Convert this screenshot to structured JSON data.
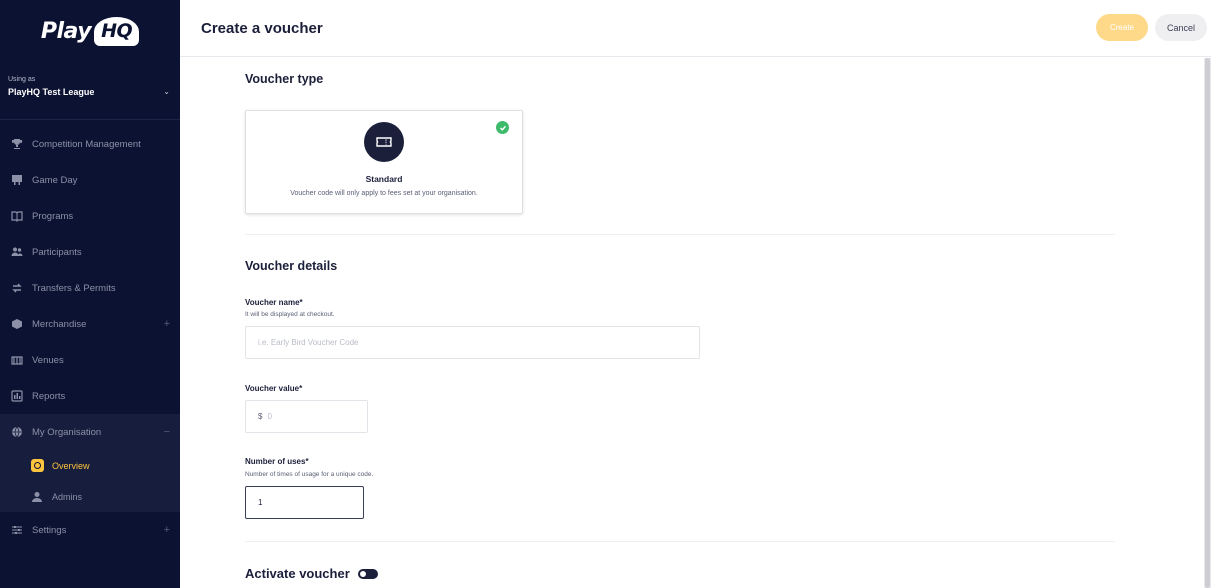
{
  "app": {
    "logo_text": "Play",
    "logo_hq": "HQ"
  },
  "sidebar": {
    "using_label": "Using as",
    "org_name": "PlayHQ Test League",
    "items": [
      {
        "label": "Competition Management",
        "icon": "trophy-icon"
      },
      {
        "label": "Game Day",
        "icon": "scoreboard-icon"
      },
      {
        "label": "Programs",
        "icon": "book-icon"
      },
      {
        "label": "Participants",
        "icon": "people-icon"
      },
      {
        "label": "Transfers & Permits",
        "icon": "transfer-icon"
      },
      {
        "label": "Merchandise",
        "icon": "merchandise-icon"
      },
      {
        "label": "Venues",
        "icon": "stadium-icon"
      },
      {
        "label": "Reports",
        "icon": "reports-icon"
      },
      {
        "label": "My Organisation",
        "icon": "globe-icon"
      }
    ],
    "sub_items": [
      {
        "label": "Overview",
        "icon": "overview-icon",
        "active": true
      },
      {
        "label": "Admins",
        "icon": "admin-icon",
        "active": false
      }
    ],
    "settings_label": "Settings",
    "plus": "+",
    "minus": "−"
  },
  "header": {
    "title": "Create a voucher",
    "create_label": "Create",
    "cancel_label": "Cancel"
  },
  "voucher_type": {
    "section_title": "Voucher type",
    "option_label": "Standard",
    "option_desc": "Voucher code will only apply to fees set at your organisation."
  },
  "voucher_details": {
    "section_title": "Voucher details",
    "name_label": "Voucher name*",
    "name_hint": "It will be displayed at checkout.",
    "name_placeholder": "i.e. Early Bird Voucher Code",
    "value_label": "Voucher value*",
    "value_prefix": "$",
    "value_placeholder": "0",
    "uses_label": "Number of uses*",
    "uses_hint": "Number of times of usage for a unique code.",
    "uses_value": "1",
    "activate_label": "Activate voucher"
  },
  "colors": {
    "sidebar_bg": "#0c1232",
    "accent": "#ffc43d",
    "check": "#3dbb6b"
  }
}
